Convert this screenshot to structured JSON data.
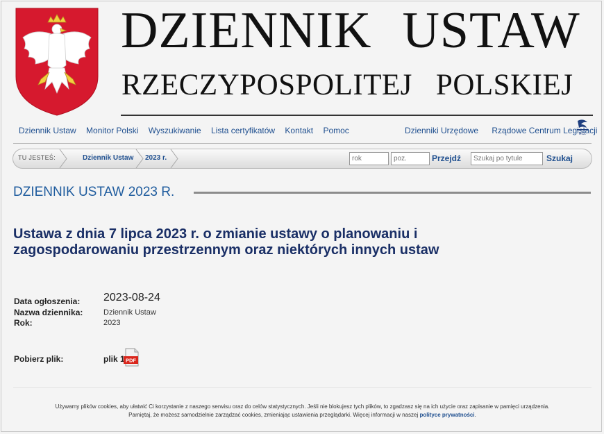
{
  "header": {
    "title_word1": "DZIENNIK",
    "title_word2": "USTAW",
    "subtitle_word1": "RZECZYPOSPOLITEJ",
    "subtitle_word2": "POLSKIEJ"
  },
  "nav": {
    "left": [
      "Dziennik Ustaw",
      "Monitor Polski",
      "Wyszukiwanie",
      "Lista certyfikatów",
      "Kontakt",
      "Pomoc"
    ],
    "right": [
      "Dzienniki Urzędowe",
      "Rządowe Centrum Legislacji"
    ],
    "rcl_logo_text": "RCL"
  },
  "breadcrumb": {
    "label": "TU JESTEŚ:",
    "items": [
      "Dziennik Ustaw",
      "2023 r."
    ]
  },
  "search": {
    "year_placeholder": "rok",
    "position_placeholder": "poz.",
    "go_label": "Przejdź",
    "title_placeholder": "Szukaj po tytule",
    "search_label": "Szukaj"
  },
  "section_heading": "DZIENNIK USTAW 2023 R.",
  "document": {
    "title": "Ustawa z dnia 7 lipca 2023 r. o zmianie ustawy o planowaniu i zagospodarowaniu przestrzennym oraz niektórych innych ustaw",
    "meta": {
      "date_label": "Data ogłoszenia:",
      "date_value": "2023-08-24",
      "journal_label": "Nazwa dziennika:",
      "journal_value": "Dziennik Ustaw",
      "year_label": "Rok:",
      "year_value": "2023"
    },
    "download_label": "Pobierz plik:",
    "file_link": "plik 1",
    "file_icon_text": "PDF"
  },
  "cookie": {
    "line1": "Używamy plików cookies, aby ułatwić Ci korzystanie z naszego serwisu oraz do celów statystycznych. Jeśli nie blokujesz tych plików, to zgadzasz się na ich użycie oraz zapisanie w pamięci urządzenia.",
    "line2": "Pamiętaj, że możesz samodzielnie zarządzać cookies, zmieniając ustawienia przeglądarki. Więcej informacji w naszej",
    "link": "polityce prywatności",
    "end": "."
  },
  "colors": {
    "link": "#1f4f8f",
    "heading": "#1f5c9e",
    "doc_title": "#1a2f66",
    "emblem_red": "#d6192e"
  }
}
